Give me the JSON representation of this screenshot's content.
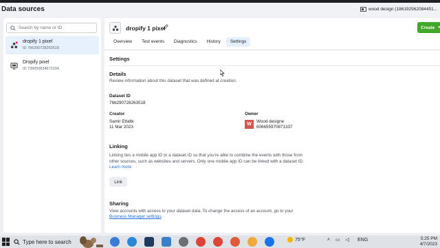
{
  "page": {
    "title": "Data sources"
  },
  "account": {
    "name": "wood design (186192562084451..."
  },
  "sidebar": {
    "search_placeholder": "Search by name or ID",
    "items": [
      {
        "name": "dropify 1 pixel",
        "id": "ID 766290728263518",
        "selected": true
      },
      {
        "name": "Dropify pixel",
        "id": "ID 739050834672194",
        "selected": false
      }
    ]
  },
  "dataset": {
    "title": "dropify 1 pixel",
    "create_label": "Create",
    "tabs": [
      "Overview",
      "Test events",
      "Diagnostics",
      "History",
      "Settings"
    ],
    "active_tab": "Settings"
  },
  "settings": {
    "heading": "Settings",
    "details": {
      "heading": "Details",
      "description": "Review information about this dataset that was defined at creation.",
      "id_label": "Dataset ID",
      "id_value": "766290728263518",
      "creator_label": "Creator",
      "creator_name": "Samir Ettalbi",
      "creator_date": "11 Mar 2023",
      "owner_label": "Owner",
      "owner_initial": "W",
      "owner_name": "Wood designe",
      "owner_id": "606655970871337"
    },
    "linking": {
      "heading": "Linking",
      "line1": "Linking ties a mobile app ID to a dataset ID so that you're able to combine the events with those from",
      "line2": "other sources, such as websites and servers. Only one mobile app ID can be linked with a dataset ID.",
      "learn_more": "Learn more",
      "button": "Link"
    },
    "sharing": {
      "heading": "Sharing",
      "line1": "View accounts with access to your dataset data. To change the access of an account, go to your",
      "link": "Business Manager settings",
      "after_link": "."
    }
  },
  "taskbar": {
    "search_text": "Type here to search",
    "weather": "75°F",
    "lang": "ENG",
    "time": "5:25 PM",
    "date": "4/7/2023"
  },
  "colors": {
    "accent": "#42a829",
    "link": "#216fdb",
    "selected_bg": "#e7f0fd"
  }
}
